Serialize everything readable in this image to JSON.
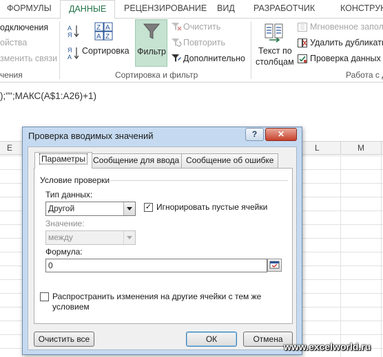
{
  "ribbon": {
    "tabs": [
      "ФОРМУЛЫ",
      "ДАННЫЕ",
      "РЕЦЕНЗИРОВАНИЕ",
      "ВИД",
      "РАЗРАБОТЧИК",
      "КОНСТРУК"
    ],
    "connections": {
      "item1": "одключения",
      "item2": "ойства",
      "item3": "зменить связи",
      "group": "чения"
    },
    "sort_filter": {
      "sort_label": "Сортировка",
      "filter_label": "Фильтр",
      "clear": "Очистить",
      "reapply": "Повторить",
      "advanced": "Дополнительно",
      "group": "Сортировка и фильтр"
    },
    "data_tools": {
      "text_to_columns_1": "Текст по",
      "text_to_columns_2": "столбцам",
      "flash_fill": "Мгновенное заполн",
      "remove_duplicates": "Удалить дубликаты",
      "validation": "Проверка данных",
      "group": "Работа с д"
    }
  },
  "formula_bar": {
    "text": ");\"\";МАКС(A$1:A26)+1)"
  },
  "sheet": {
    "columns": [
      "E",
      "L",
      "M"
    ]
  },
  "dialog": {
    "title": "Проверка вводимых значений",
    "help": "?",
    "close": "✕",
    "tabs": [
      "Параметры",
      "Сообщение для ввода",
      "Сообщение об ошибке"
    ],
    "section": "Условие проверки",
    "data_type_label": "Тип данных:",
    "data_type_value": "Другой",
    "ignore_blank": "Игнорировать пустые ячейки",
    "value_label": "Значение:",
    "value_value": "между",
    "formula_label": "Формула:",
    "formula_value": "0",
    "apply_all": "Распространить изменения на другие ячейки с тем же условием",
    "clear_all": "Очистить все",
    "ok": "ОК",
    "cancel": "Отмена"
  },
  "watermark": "www.excelworld.ru",
  "colors": {
    "accent": "#217346",
    "filter_active": "#c6e2d1",
    "dialog_frame": "#c5daf0"
  }
}
